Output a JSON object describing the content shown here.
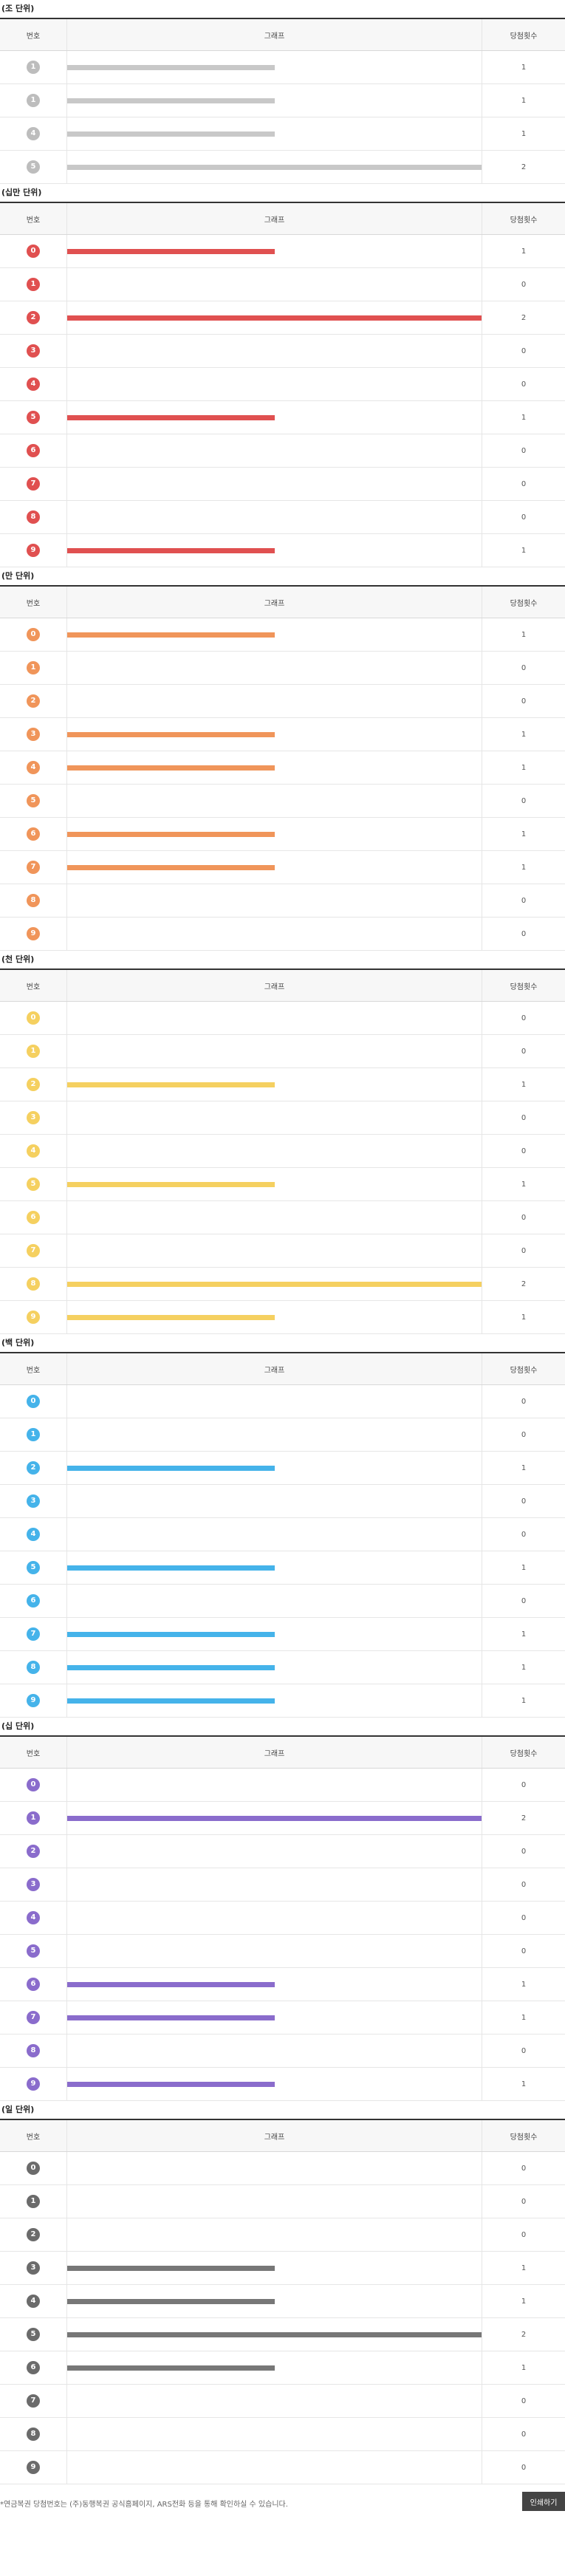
{
  "headers": {
    "num": "번호",
    "graph": "그래프",
    "count": "당첨횟수"
  },
  "max_count": 2,
  "sections": [
    {
      "title": "(조 단위)",
      "color": "#bdbdbd",
      "bar_color": "#c8c8c8",
      "rows": [
        {
          "num": "1",
          "count": 1
        },
        {
          "num": "1",
          "count": 1
        },
        {
          "num": "4",
          "count": 1
        },
        {
          "num": "5",
          "count": 2
        }
      ]
    },
    {
      "title": "(십만 단위)",
      "color": "#e05050",
      "bar_color": "#e05050",
      "rows": [
        {
          "num": "0",
          "count": 1
        },
        {
          "num": "1",
          "count": 0
        },
        {
          "num": "2",
          "count": 2
        },
        {
          "num": "3",
          "count": 0
        },
        {
          "num": "4",
          "count": 0
        },
        {
          "num": "5",
          "count": 1
        },
        {
          "num": "6",
          "count": 0
        },
        {
          "num": "7",
          "count": 0
        },
        {
          "num": "8",
          "count": 0
        },
        {
          "num": "9",
          "count": 1
        }
      ]
    },
    {
      "title": "(만 단위)",
      "color": "#f0955a",
      "bar_color": "#f0955a",
      "rows": [
        {
          "num": "0",
          "count": 1
        },
        {
          "num": "1",
          "count": 0
        },
        {
          "num": "2",
          "count": 0
        },
        {
          "num": "3",
          "count": 1
        },
        {
          "num": "4",
          "count": 1
        },
        {
          "num": "5",
          "count": 0
        },
        {
          "num": "6",
          "count": 1
        },
        {
          "num": "7",
          "count": 1
        },
        {
          "num": "8",
          "count": 0
        },
        {
          "num": "9",
          "count": 0
        }
      ]
    },
    {
      "title": "(천 단위)",
      "color": "#f5d060",
      "bar_color": "#f5d060",
      "rows": [
        {
          "num": "0",
          "count": 0
        },
        {
          "num": "1",
          "count": 0
        },
        {
          "num": "2",
          "count": 1
        },
        {
          "num": "3",
          "count": 0
        },
        {
          "num": "4",
          "count": 0
        },
        {
          "num": "5",
          "count": 1
        },
        {
          "num": "6",
          "count": 0
        },
        {
          "num": "7",
          "count": 0
        },
        {
          "num": "8",
          "count": 2
        },
        {
          "num": "9",
          "count": 1
        }
      ]
    },
    {
      "title": "(백 단위)",
      "color": "#45b3ea",
      "bar_color": "#45b3ea",
      "rows": [
        {
          "num": "0",
          "count": 0
        },
        {
          "num": "1",
          "count": 0
        },
        {
          "num": "2",
          "count": 1
        },
        {
          "num": "3",
          "count": 0
        },
        {
          "num": "4",
          "count": 0
        },
        {
          "num": "5",
          "count": 1
        },
        {
          "num": "6",
          "count": 0
        },
        {
          "num": "7",
          "count": 1
        },
        {
          "num": "8",
          "count": 1
        },
        {
          "num": "9",
          "count": 1
        }
      ]
    },
    {
      "title": "(십 단위)",
      "color": "#8a6ccc",
      "bar_color": "#8a6ccc",
      "rows": [
        {
          "num": "0",
          "count": 0
        },
        {
          "num": "1",
          "count": 2
        },
        {
          "num": "2",
          "count": 0
        },
        {
          "num": "3",
          "count": 0
        },
        {
          "num": "4",
          "count": 0
        },
        {
          "num": "5",
          "count": 0
        },
        {
          "num": "6",
          "count": 1
        },
        {
          "num": "7",
          "count": 1
        },
        {
          "num": "8",
          "count": 0
        },
        {
          "num": "9",
          "count": 1
        }
      ]
    },
    {
      "title": "(일 단위)",
      "color": "#6b6b6b",
      "bar_color": "#777777",
      "rows": [
        {
          "num": "0",
          "count": 0
        },
        {
          "num": "1",
          "count": 0
        },
        {
          "num": "2",
          "count": 0
        },
        {
          "num": "3",
          "count": 1
        },
        {
          "num": "4",
          "count": 1
        },
        {
          "num": "5",
          "count": 2
        },
        {
          "num": "6",
          "count": 1
        },
        {
          "num": "7",
          "count": 0
        },
        {
          "num": "8",
          "count": 0
        },
        {
          "num": "9",
          "count": 0
        }
      ]
    }
  ],
  "footer": {
    "note": "*연금복권 당첨번호는 (주)동행복권 공식홈페이지, ARS전화 등을 통해 확인하실 수 있습니다.",
    "print_label": "인쇄하기"
  }
}
